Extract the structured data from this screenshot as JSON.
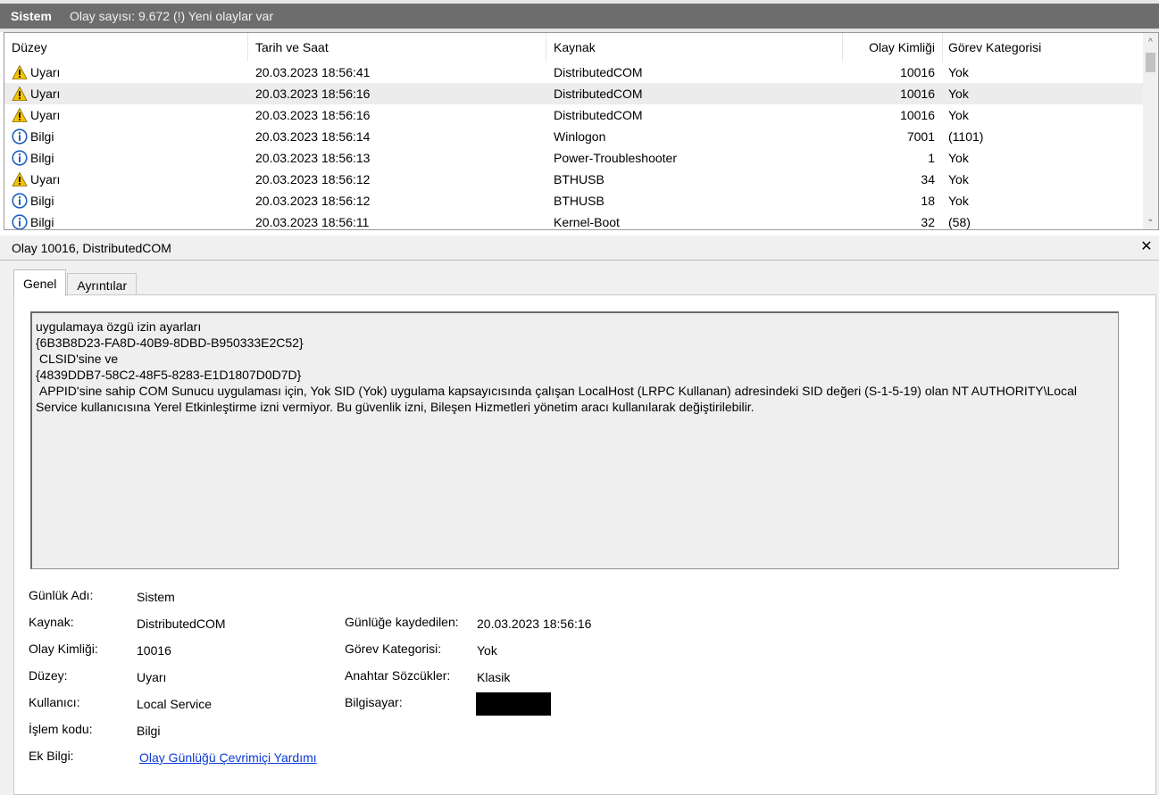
{
  "header": {
    "log_name": "Sistem",
    "event_count": "Olay sayısı: 9.672 (!) Yeni olaylar var"
  },
  "list": {
    "columns": [
      "Düzey",
      "Tarih ve Saat",
      "Kaynak",
      "Olay Kimliği",
      "Görev Kategorisi"
    ],
    "rows": [
      {
        "level": "Uyarı",
        "icon": "warning-icon",
        "date": "20.03.2023 18:56:41",
        "source": "DistributedCOM",
        "id": "10016",
        "category": "Yok",
        "selected": false
      },
      {
        "level": "Uyarı",
        "icon": "warning-icon",
        "date": "20.03.2023 18:56:16",
        "source": "DistributedCOM",
        "id": "10016",
        "category": "Yok",
        "selected": true
      },
      {
        "level": "Uyarı",
        "icon": "warning-icon",
        "date": "20.03.2023 18:56:16",
        "source": "DistributedCOM",
        "id": "10016",
        "category": "Yok",
        "selected": false
      },
      {
        "level": "Bilgi",
        "icon": "info-icon",
        "date": "20.03.2023 18:56:14",
        "source": "Winlogon",
        "id": "7001",
        "category": "(1101)",
        "selected": false
      },
      {
        "level": "Bilgi",
        "icon": "info-icon",
        "date": "20.03.2023 18:56:13",
        "source": "Power-Troubleshooter",
        "id": "1",
        "category": "Yok",
        "selected": false
      },
      {
        "level": "Uyarı",
        "icon": "warning-icon",
        "date": "20.03.2023 18:56:12",
        "source": "BTHUSB",
        "id": "34",
        "category": "Yok",
        "selected": false
      },
      {
        "level": "Bilgi",
        "icon": "info-icon",
        "date": "20.03.2023 18:56:12",
        "source": "BTHUSB",
        "id": "18",
        "category": "Yok",
        "selected": false
      },
      {
        "level": "Bilgi",
        "icon": "info-icon",
        "date": "20.03.2023 18:56:11",
        "source": "Kernel-Boot",
        "id": "32",
        "category": "(58)",
        "selected": false
      }
    ]
  },
  "detail": {
    "title": "Olay 10016, DistributedCOM",
    "tabs": [
      "Genel",
      "Ayrıntılar"
    ],
    "message": [
      "uygulamaya özgü izin ayarları",
      "{6B3B8D23-FA8D-40B9-8DBD-B950333E2C52}",
      " CLSID'sine ve",
      "{4839DDB7-58C2-48F5-8283-E1D1807D0D7D}",
      " APPID'sine sahip COM Sunucu uygulaması için, Yok SID (Yok) uygulama kapsayıcısında çalışan LocalHost (LRPC Kullanan) adresindeki SID değeri (S-1-5-19) olan NT AUTHORITY\\Local Service kullanıcısına Yerel Etkinleştirme izni vermiyor. Bu güvenlik izni, Bileşen Hizmetleri yönetim aracı kullanılarak değiştirilebilir."
    ],
    "fields": {
      "log_name_label": "Günlük Adı:",
      "log_name": "Sistem",
      "source_label": "Kaynak:",
      "source": "DistributedCOM",
      "logged_label": "Günlüğe kaydedilen:",
      "logged": "20.03.2023 18:56:16",
      "event_id_label": "Olay Kimliği:",
      "event_id": "10016",
      "task_label": "Görev Kategorisi:",
      "task": "Yok",
      "level_label": "Düzey:",
      "level": "Uyarı",
      "keywords_label": "Anahtar Sözcükler:",
      "keywords": "Klasik",
      "user_label": "Kullanıcı:",
      "user": "Local Service",
      "computer_label": "Bilgisayar:",
      "opcode_label": "İşlem kodu:",
      "opcode": "Bilgi",
      "more_info_label": "Ek Bilgi:",
      "more_info_link": "Olay Günlüğü Çevrimiçi Yardımı"
    }
  },
  "colors": {
    "header_bg": "#6d6d6d",
    "selected_row": "#ececec",
    "link": "#0b39d6",
    "warning_yellow": "#f5c400",
    "info_blue": "#1f5fbf"
  }
}
